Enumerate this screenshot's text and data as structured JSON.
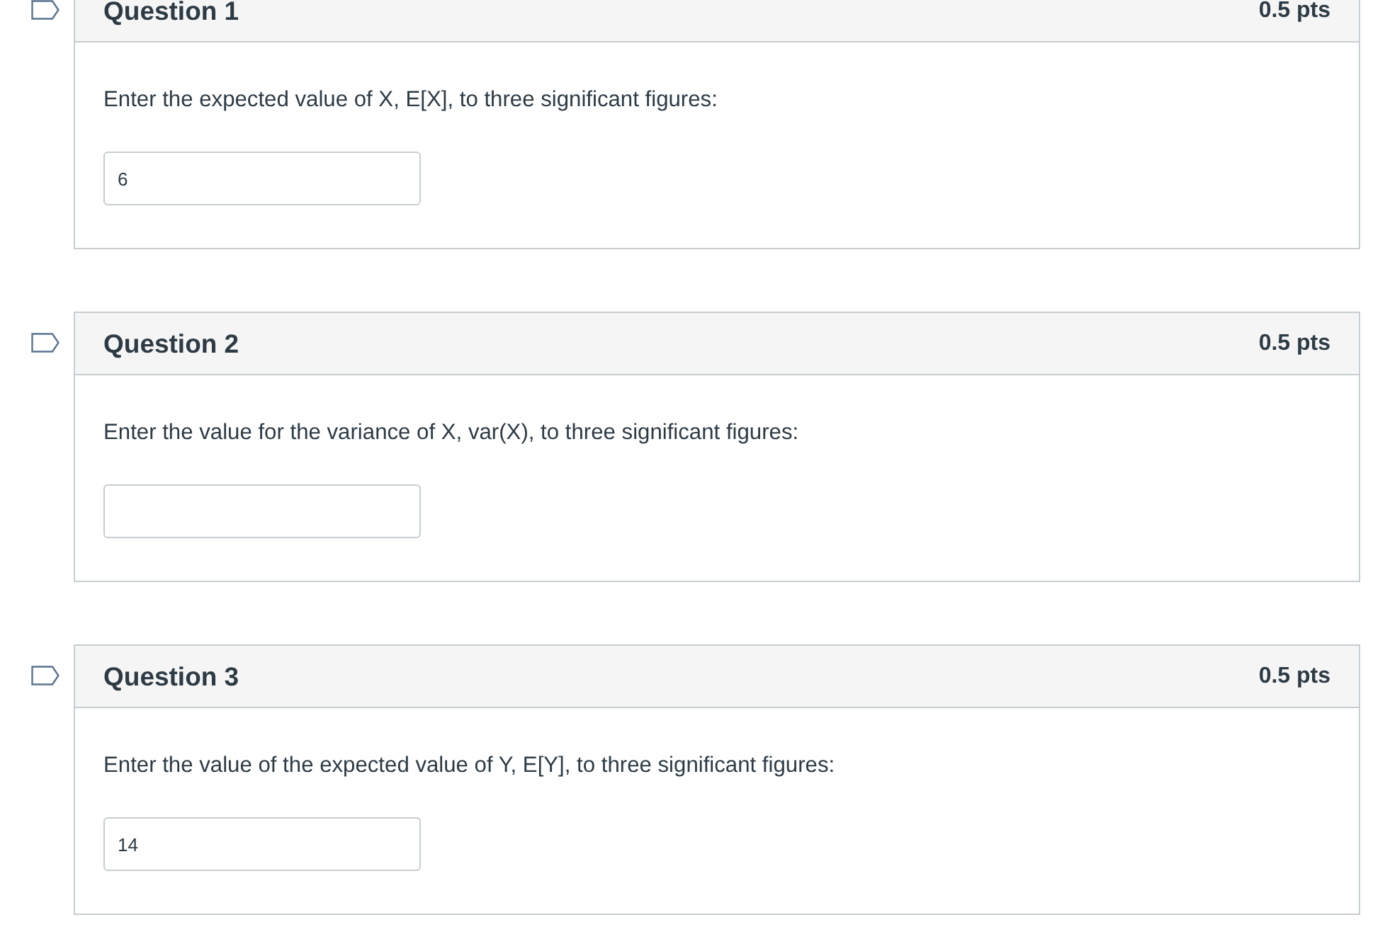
{
  "questions": [
    {
      "title": "Question 1",
      "points": "0.5 pts",
      "prompt": "Enter the expected value of X, E[X], to three significant figures:",
      "answer": "6"
    },
    {
      "title": "Question 2",
      "points": "0.5 pts",
      "prompt": "Enter the value for the variance of X, var(X), to three significant figures:"
    },
    {
      "title": "Question 3",
      "points": "0.5 pts",
      "prompt": "Enter the value of the expected value of Y, E[Y], to three significant figures:",
      "answer": "14"
    }
  ]
}
